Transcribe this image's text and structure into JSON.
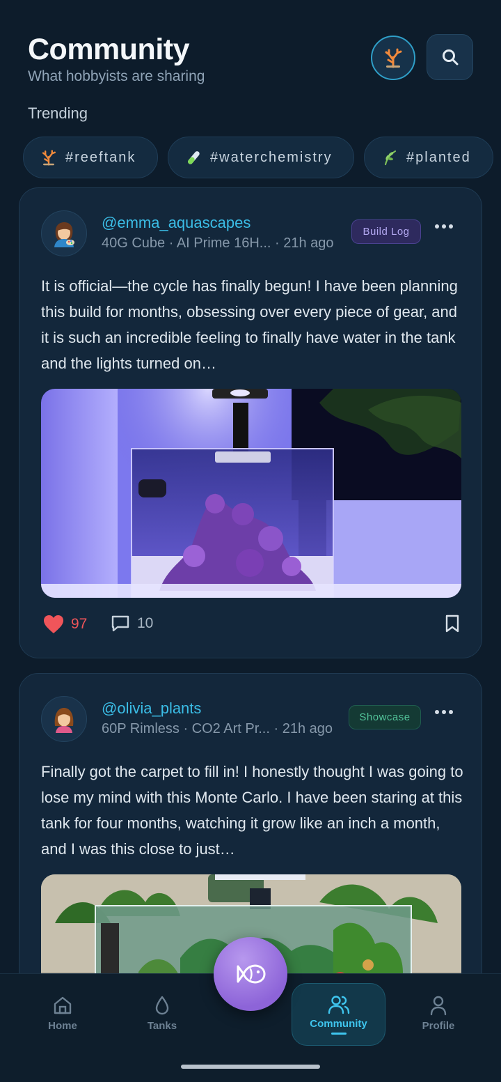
{
  "header": {
    "title": "Community",
    "subtitle": "What hobbyists are sharing"
  },
  "trending": {
    "label": "Trending",
    "chips": [
      {
        "label": "#reeftank",
        "icon": "coral-icon"
      },
      {
        "label": "#waterchemistry",
        "icon": "test-tube-icon"
      },
      {
        "label": "#planted",
        "icon": "plant-icon"
      }
    ]
  },
  "posts": [
    {
      "username": "@emma_aquascapes",
      "tank": "40G Cube · AI Prime 16H...",
      "time": "· 21h ago",
      "badge": "Build Log",
      "text": "It is official—the cycle has finally begun! I have been planning this build for months, obsessing over every piece of gear, and it is such an incredible feeling to finally have water in the tank and the lights turned on…",
      "likes": "97",
      "comments": "10",
      "avatar": "woman-artist-emoji",
      "image": "reef-cube-tank-photo"
    },
    {
      "username": "@olivia_plants",
      "tank": "60P Rimless · CO2 Art Pr...",
      "time": "· 21h ago",
      "badge": "Showcase",
      "text": "Finally got the carpet to fill in! I honestly thought I was going to lose my mind with this Monte Carlo. I have been staring at this tank for four months, watching it grow like an inch a month, and I was this close to just…",
      "avatar": "woman-emoji",
      "image": "planted-rimless-tank-photo"
    }
  ],
  "nav": {
    "home": "Home",
    "tanks": "Tanks",
    "community": "Community",
    "profile": "Profile"
  },
  "colors": {
    "background": "#0d1c2b",
    "card": "#13273b",
    "accent": "#3fc5ee",
    "like": "#f0555a",
    "fab": "#9a72e0"
  }
}
